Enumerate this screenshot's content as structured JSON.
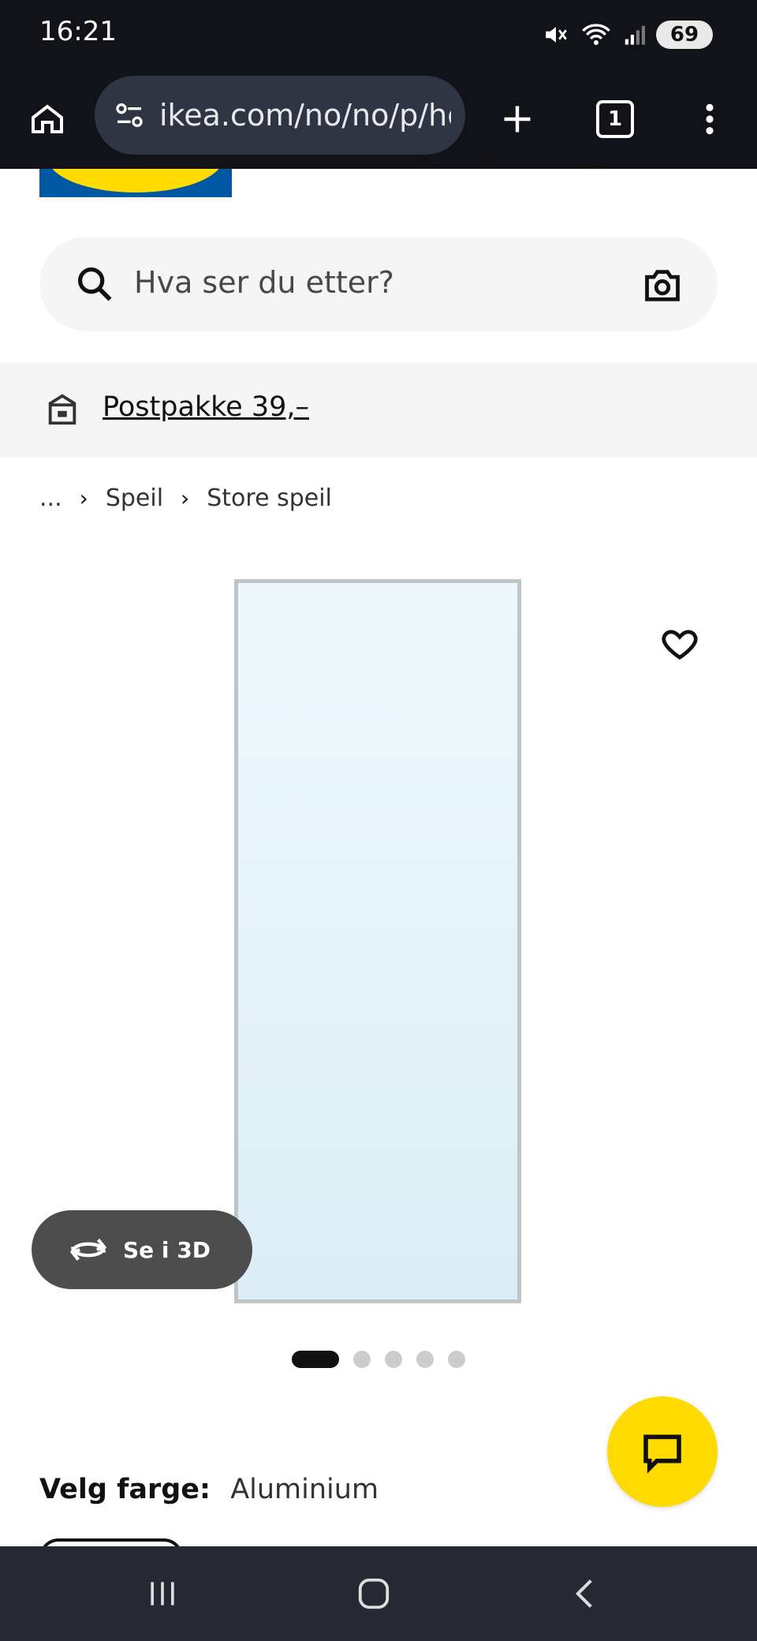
{
  "status_bar": {
    "time": "16:21",
    "battery_level": "69",
    "icons": [
      "mute-icon",
      "wifi-icon",
      "signal-icon",
      "battery-icon"
    ]
  },
  "browser": {
    "url": "ikea.com/no/no/p/hov",
    "tab_count": "1"
  },
  "search": {
    "placeholder": "Hva ser du etter?"
  },
  "promo": {
    "text": "Postpakke 39,–"
  },
  "breadcrumb": {
    "items": [
      "...",
      "Speil",
      "Store speil"
    ]
  },
  "gallery": {
    "see_3d_label": "Se i 3D",
    "page_count": 5,
    "active_page": 1
  },
  "product": {
    "color_label": "Velg farge:",
    "color_value": "Aluminium"
  },
  "colors": {
    "accent_yellow": "#ffdb00",
    "brand_blue": "#0058a3",
    "dark_bar": "#111318"
  }
}
